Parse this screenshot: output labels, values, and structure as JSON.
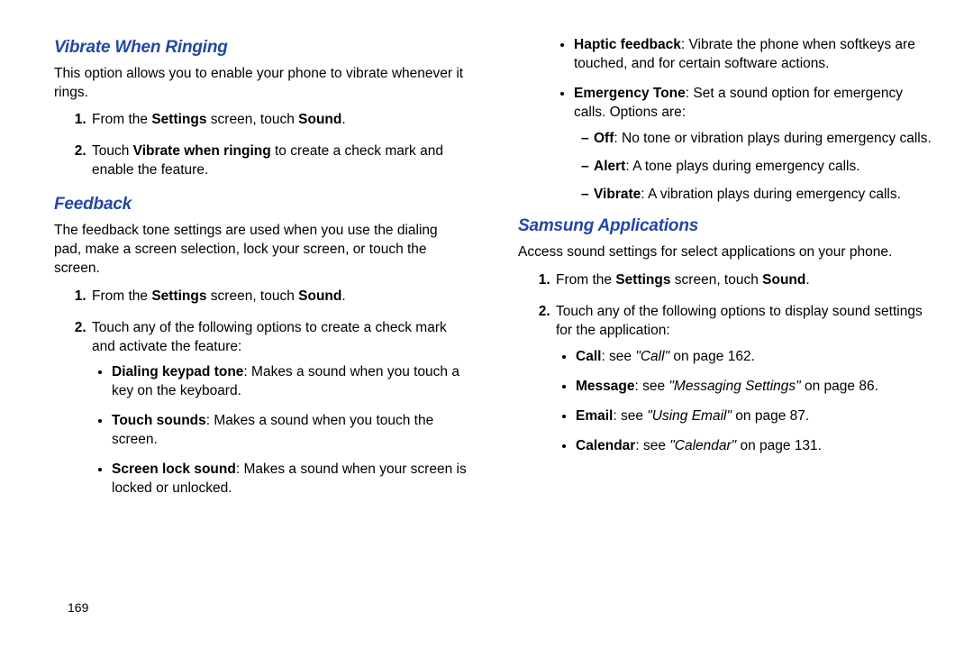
{
  "page_number": "169",
  "left": {
    "sect1": {
      "heading": "Vibrate When Ringing",
      "para": "This option allows you to enable your phone to vibrate whenever it rings.",
      "step1_pre": "From the ",
      "step1_b1": "Settings",
      "step1_mid": " screen, touch ",
      "step1_b2": "Sound",
      "step1_post": ".",
      "step2_pre": "Touch ",
      "step2_b1": "Vibrate when ringing",
      "step2_post": " to create a check mark and enable the feature."
    },
    "sect2": {
      "heading": "Feedback",
      "para": "The feedback tone settings are used when you use the dialing pad, make a screen selection, lock your screen, or touch the screen.",
      "step1_pre": "From the ",
      "step1_b1": "Settings",
      "step1_mid": " screen, touch ",
      "step1_b2": "Sound",
      "step1_post": ".",
      "step2": "Touch any of the following options to create a check mark and activate the feature:",
      "b1_b": "Dialing keypad tone",
      "b1_t": ": Makes a sound when you touch a key on the keyboard.",
      "b2_b": "Touch sounds",
      "b2_t": ": Makes a sound when you touch the screen.",
      "b3_b": "Screen lock sound",
      "b3_t": ": Makes a sound when your screen is locked or unlocked."
    }
  },
  "right": {
    "cont": {
      "b1_b": "Haptic feedback",
      "b1_t": ": Vibrate the phone when softkeys are touched, and for certain software actions.",
      "b2_b": "Emergency Tone",
      "b2_t": ": Set a sound option for emergency calls. Options are:",
      "s1_b": "Off",
      "s1_t": ": No tone or vibration plays during emergency calls.",
      "s2_b": "Alert",
      "s2_t": ": A tone plays during emergency calls.",
      "s3_b": "Vibrate",
      "s3_t": ": A vibration plays during emergency calls."
    },
    "sect3": {
      "heading": "Samsung Applications",
      "para": "Access sound settings for select applications on your phone.",
      "step1_pre": "From the ",
      "step1_b1": "Settings",
      "step1_mid": " screen, touch ",
      "step1_b2": "Sound",
      "step1_post": ".",
      "step2": "Touch any of the following options to display sound settings for the application:",
      "b1_b": "Call",
      "b1_pre": ": see ",
      "b1_i": "\"Call\"",
      "b1_post": " on page 162.",
      "b2_b": "Message",
      "b2_pre": ": see ",
      "b2_i": "\"Messaging Settings\"",
      "b2_post": " on page 86.",
      "b3_b": "Email",
      "b3_pre": ": see ",
      "b3_i": "\"Using Email\"",
      "b3_post": " on page 87.",
      "b4_b": "Calendar",
      "b4_pre": ": see ",
      "b4_i": "\"Calendar\"",
      "b4_post": " on page 131."
    }
  }
}
